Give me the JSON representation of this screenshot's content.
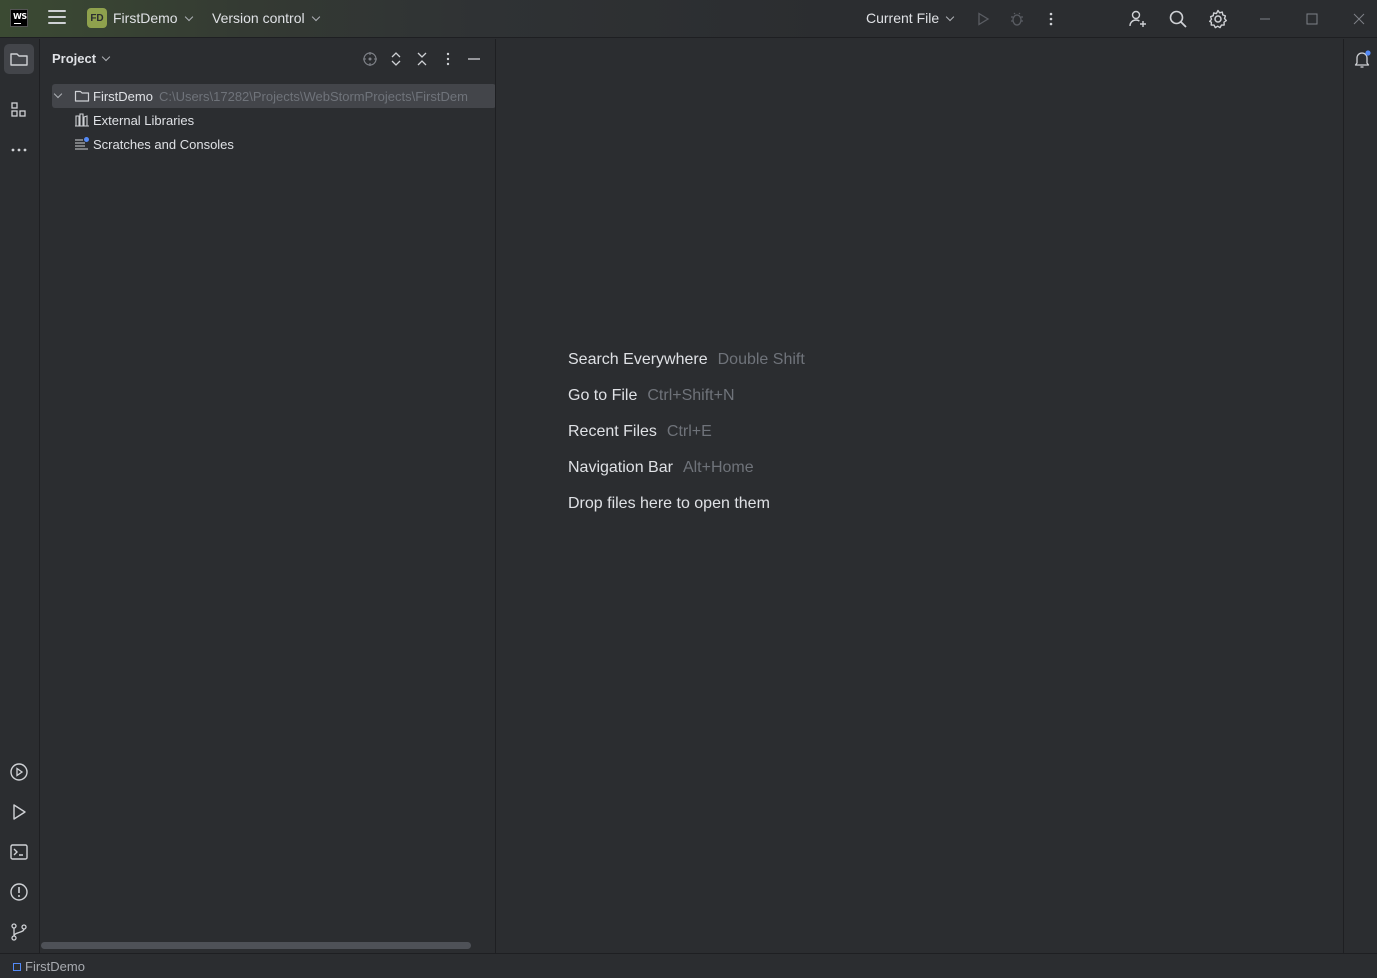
{
  "titlebar": {
    "logo_text": "WS",
    "project_badge": "FD",
    "project_name": "FirstDemo",
    "vcs_label": "Version control",
    "run_config": "Current File",
    "icons": [
      "hamburger-menu-icon",
      "run-icon",
      "debug-icon",
      "more-vertical-icon",
      "add-user-icon",
      "search-icon",
      "settings-gear-icon",
      "minimize-icon",
      "maximize-icon",
      "close-icon"
    ]
  },
  "left_strip": {
    "top_icons": [
      "project-folder-icon",
      "structure-icon",
      "more-horizontal-icon"
    ],
    "bottom_icons": [
      "services-icon",
      "run-icon",
      "terminal-icon",
      "problems-icon",
      "git-icon"
    ]
  },
  "project_panel": {
    "title": "Project",
    "tree": [
      {
        "label": "FirstDemo",
        "path": "C:\\Users\\17282\\Projects\\WebStormProjects\\FirstDem",
        "icon": "folder-icon",
        "expanded": true,
        "selected": true
      },
      {
        "label": "External Libraries",
        "icon": "libraries-icon"
      },
      {
        "label": "Scratches and Consoles",
        "icon": "scratches-icon"
      }
    ]
  },
  "editor": {
    "hints": [
      {
        "action": "Search Everywhere",
        "shortcut": "Double Shift"
      },
      {
        "action": "Go to File",
        "shortcut": "Ctrl+Shift+N"
      },
      {
        "action": "Recent Files",
        "shortcut": "Ctrl+E"
      },
      {
        "action": "Navigation Bar",
        "shortcut": "Alt+Home"
      },
      {
        "action": "Drop files here to open them",
        "shortcut": ""
      }
    ]
  },
  "statusbar": {
    "project": "FirstDemo"
  },
  "colors": {
    "background": "#2b2d30",
    "editor_bg": "#1e1f22",
    "accent_blue": "#548af7",
    "badge_green": "#8fa14d",
    "muted_text": "#6f737a"
  }
}
